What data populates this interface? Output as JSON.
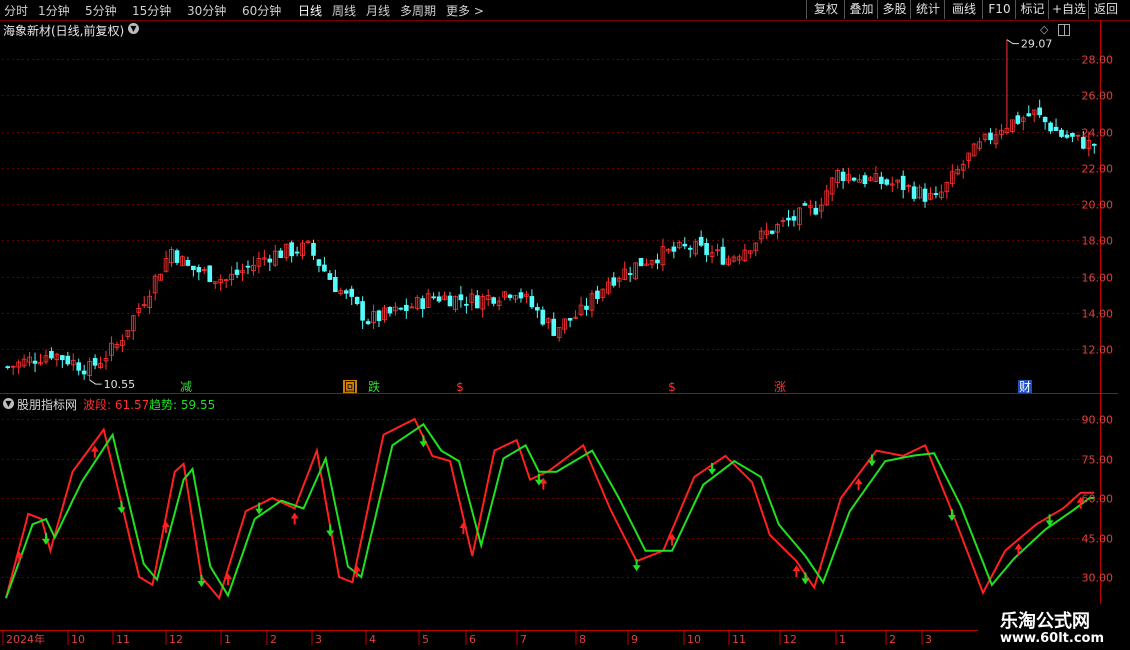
{
  "toolbar": {
    "periods": [
      "分时",
      "1分钟",
      "5分钟",
      "15分钟",
      "30分钟",
      "60分钟",
      "日线",
      "周线",
      "月线",
      "多周期",
      "更多 >"
    ],
    "active_period": "日线",
    "right_buttons": [
      "复权",
      "叠加",
      "多股",
      "统计",
      "画线",
      "F10",
      "标记",
      "+自选",
      "返回"
    ]
  },
  "stock_title": "海象新材(日线,前复权)",
  "indicator": {
    "name": "股朋指标网",
    "wave_label": "波段: 61.57",
    "trend_label": "趋势: 59.55",
    "wave_color": "#ff2020",
    "trend_color": "#20e020"
  },
  "watermark": {
    "line1": "乐淘公式网",
    "line2": "www.60lt.com"
  },
  "colors": {
    "up": "#ff3232",
    "down": "#54fcfc",
    "grid": "#6b0000",
    "axis": "#c00000"
  },
  "chart_data": [
    {
      "type": "candlestick",
      "title": "海象新材(日线,前复权)",
      "ylim": [
        10.5,
        29.5
      ],
      "y_ticks": [
        "12.00",
        "14.00",
        "16.00",
        "18.00",
        "20.00",
        "22.00",
        "24.00",
        "26.00",
        "28.00"
      ],
      "n_bars": 200,
      "close_anchors": [
        [
          0,
          11.0
        ],
        [
          8,
          11.8
        ],
        [
          15,
          10.9
        ],
        [
          20,
          12.2
        ],
        [
          25,
          14.8
        ],
        [
          30,
          17.5
        ],
        [
          33,
          16.5
        ],
        [
          40,
          15.8
        ],
        [
          48,
          17.2
        ],
        [
          55,
          17.6
        ],
        [
          60,
          15.5
        ],
        [
          66,
          13.6
        ],
        [
          72,
          14.1
        ],
        [
          78,
          14.9
        ],
        [
          86,
          14.7
        ],
        [
          93,
          15.3
        ],
        [
          100,
          13.1
        ],
        [
          105,
          14.0
        ],
        [
          110,
          15.8
        ],
        [
          118,
          17.1
        ],
        [
          125,
          17.6
        ],
        [
          132,
          17.0
        ],
        [
          140,
          18.6
        ],
        [
          148,
          19.8
        ],
        [
          152,
          21.7
        ],
        [
          158,
          21.3
        ],
        [
          164,
          21.0
        ],
        [
          170,
          20.2
        ],
        [
          176,
          22.6
        ],
        [
          182,
          24.3
        ],
        [
          188,
          25.0
        ],
        [
          193,
          23.8
        ],
        [
          198,
          23.3
        ]
      ],
      "annotations": [
        {
          "text": "29.07",
          "kind": "high"
        },
        {
          "text": "10.55",
          "kind": "low"
        }
      ],
      "signals": [
        "减",
        "回",
        "跌",
        "$",
        "$",
        "涨",
        "财"
      ]
    },
    {
      "type": "line",
      "name": "股朋指标网",
      "ylim": [
        20,
        95
      ],
      "y_ticks": [
        "30.00",
        "45.00",
        "60.00",
        "75.00",
        "90.00"
      ],
      "x_ticks": [
        "2024年",
        "10",
        "11",
        "12",
        "1",
        "2",
        "3",
        "4",
        "5",
        "6",
        "7",
        "8",
        "9",
        "10",
        "11",
        "12",
        "1",
        "2",
        "3"
      ],
      "series": [
        {
          "name": "波段",
          "color": "#ff2020",
          "last": 61.57,
          "anchors": [
            [
              0,
              22
            ],
            [
              5,
              54
            ],
            [
              8,
              52
            ],
            [
              10,
              40
            ],
            [
              15,
              70
            ],
            [
              22,
              86
            ],
            [
              30,
              30
            ],
            [
              33,
              27
            ],
            [
              38,
              70
            ],
            [
              40,
              73
            ],
            [
              44,
              30
            ],
            [
              48,
              22
            ],
            [
              54,
              55
            ],
            [
              60,
              60
            ],
            [
              65,
              56
            ],
            [
              70,
              78
            ],
            [
              75,
              30
            ],
            [
              78,
              28
            ],
            [
              85,
              84
            ],
            [
              92,
              90
            ],
            [
              96,
              76
            ],
            [
              100,
              74
            ],
            [
              105,
              38
            ],
            [
              110,
              78
            ],
            [
              115,
              82
            ],
            [
              118,
              67
            ],
            [
              122,
              70
            ],
            [
              130,
              80
            ],
            [
              136,
              56
            ],
            [
              142,
              36
            ],
            [
              148,
              40
            ],
            [
              155,
              68
            ],
            [
              162,
              76
            ],
            [
              168,
              66
            ],
            [
              172,
              46
            ],
            [
              178,
              36
            ],
            [
              182,
              26
            ],
            [
              188,
              60
            ],
            [
              196,
              78
            ],
            [
              202,
              76
            ],
            [
              207,
              80
            ],
            [
              213,
              55
            ],
            [
              220,
              24
            ],
            [
              225,
              40
            ],
            [
              232,
              50
            ],
            [
              238,
              56
            ],
            [
              242,
              62
            ],
            [
              245,
              62
            ]
          ]
        },
        {
          "name": "趋势",
          "color": "#20e020",
          "last": 59.55,
          "anchors": [
            [
              0,
              22
            ],
            [
              6,
              50
            ],
            [
              9,
              52
            ],
            [
              11,
              45
            ],
            [
              17,
              66
            ],
            [
              24,
              84
            ],
            [
              31,
              35
            ],
            [
              34,
              29
            ],
            [
              40,
              67
            ],
            [
              42,
              71
            ],
            [
              46,
              34
            ],
            [
              50,
              23
            ],
            [
              56,
              52
            ],
            [
              62,
              59
            ],
            [
              67,
              56
            ],
            [
              72,
              75
            ],
            [
              77,
              34
            ],
            [
              80,
              30
            ],
            [
              87,
              80
            ],
            [
              94,
              88
            ],
            [
              98,
              78
            ],
            [
              102,
              74
            ],
            [
              107,
              42
            ],
            [
              112,
              75
            ],
            [
              117,
              80
            ],
            [
              120,
              70
            ],
            [
              124,
              70
            ],
            [
              132,
              78
            ],
            [
              138,
              60
            ],
            [
              144,
              40
            ],
            [
              150,
              40
            ],
            [
              157,
              65
            ],
            [
              164,
              74
            ],
            [
              170,
              68
            ],
            [
              174,
              50
            ],
            [
              180,
              38
            ],
            [
              184,
              28
            ],
            [
              190,
              55
            ],
            [
              198,
              74
            ],
            [
              204,
              76
            ],
            [
              209,
              77
            ],
            [
              215,
              57
            ],
            [
              222,
              27
            ],
            [
              227,
              37
            ],
            [
              234,
              48
            ],
            [
              240,
              55
            ],
            [
              244,
              60
            ],
            [
              245,
              60
            ]
          ]
        }
      ],
      "markers_up": [
        3,
        20,
        36,
        50,
        65,
        79,
        103,
        121,
        150,
        178,
        192,
        228,
        242
      ],
      "markers_down": [
        9,
        26,
        44,
        57,
        73,
        94,
        120,
        142,
        159,
        180,
        195,
        213,
        235
      ]
    }
  ]
}
